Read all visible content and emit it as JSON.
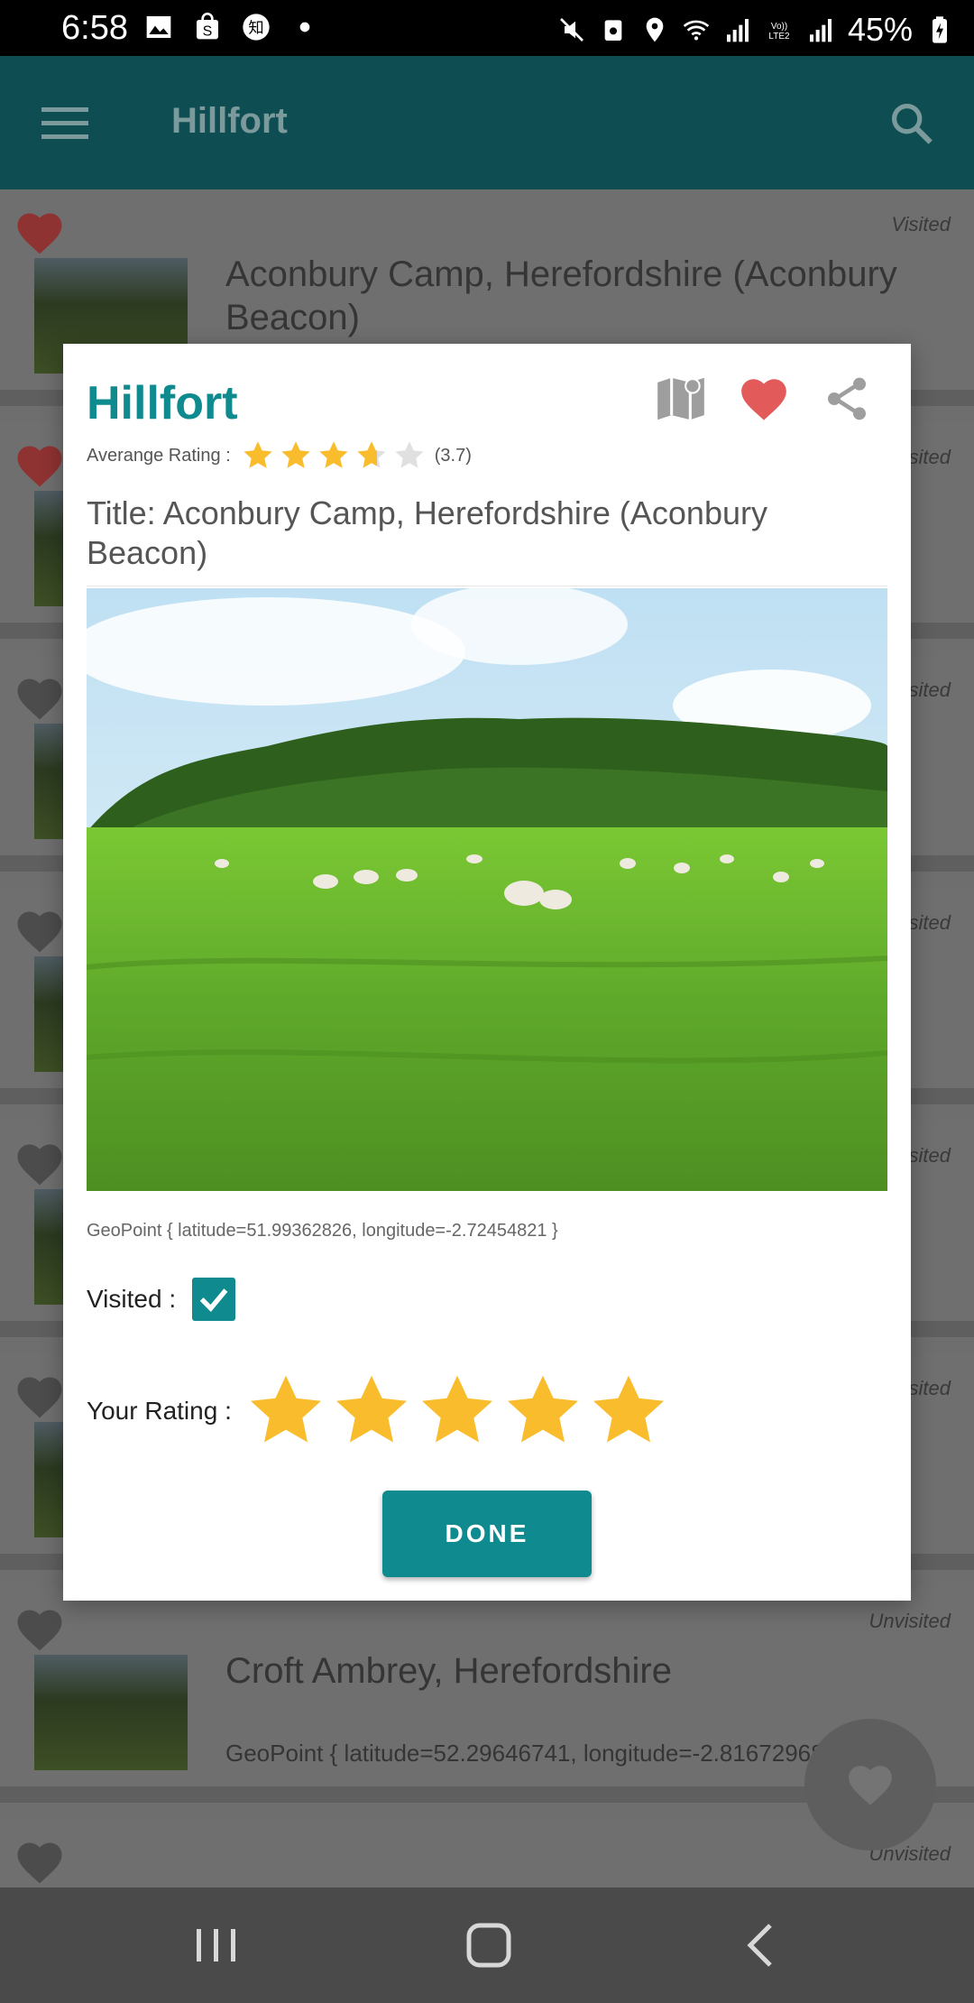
{
  "status_bar": {
    "time": "6:58",
    "battery": "45%",
    "icons": [
      "image-icon",
      "shopping-bag-icon",
      "zhihu-icon",
      "dot-icon",
      "mute-icon",
      "recycle-icon",
      "location-icon",
      "wifi-icon",
      "signal-icon",
      "volte-icon",
      "signal-icon",
      "battery-charging-icon"
    ]
  },
  "app_bar": {
    "title": "Hillfort",
    "menu_icon": "hamburger-menu-icon",
    "search_icon": "search-icon"
  },
  "list": {
    "items": [
      {
        "title": "Aconbury Camp, Herefordshire (Aconbury Beacon)",
        "status": "Visited",
        "favorite": true
      },
      {
        "title": "",
        "status": "Visited",
        "favorite": true
      },
      {
        "title": "",
        "status": "Visited",
        "favorite": false
      },
      {
        "title": "",
        "status": "Visited",
        "favorite": false
      },
      {
        "title": "",
        "status": "Visited",
        "favorite": false
      },
      {
        "title": "",
        "status": "Visited",
        "favorite": false
      },
      {
        "title": "Croft Ambrey, Herefordshire",
        "geo": "GeoPoint { latitude=52.29646741, longitude=-2.816729681 }",
        "status": "Unvisited",
        "favorite": false
      },
      {
        "title": "",
        "status": "Unvisited",
        "favorite": false
      }
    ]
  },
  "dialog": {
    "title": "Hillfort",
    "average_rating_label": "Averange Rating :",
    "average_rating": 3.7,
    "average_rating_text": "(3.7)",
    "subtitle": "Title: Aconbury Camp, Herefordshire (Aconbury Beacon)",
    "geo": "GeoPoint { latitude=51.99362826, longitude=-2.72454821 }",
    "visited_label": "Visited :",
    "visited": true,
    "your_rating_label": "Your Rating :",
    "your_rating": 5,
    "done_label": "DONE",
    "actions": [
      "map-icon",
      "heart-icon",
      "share-icon"
    ]
  },
  "colors": {
    "accent": "#0f8a8f",
    "heart": "#e35a5a",
    "star": "#f9bc2c",
    "star_empty": "#e0e0e0"
  }
}
